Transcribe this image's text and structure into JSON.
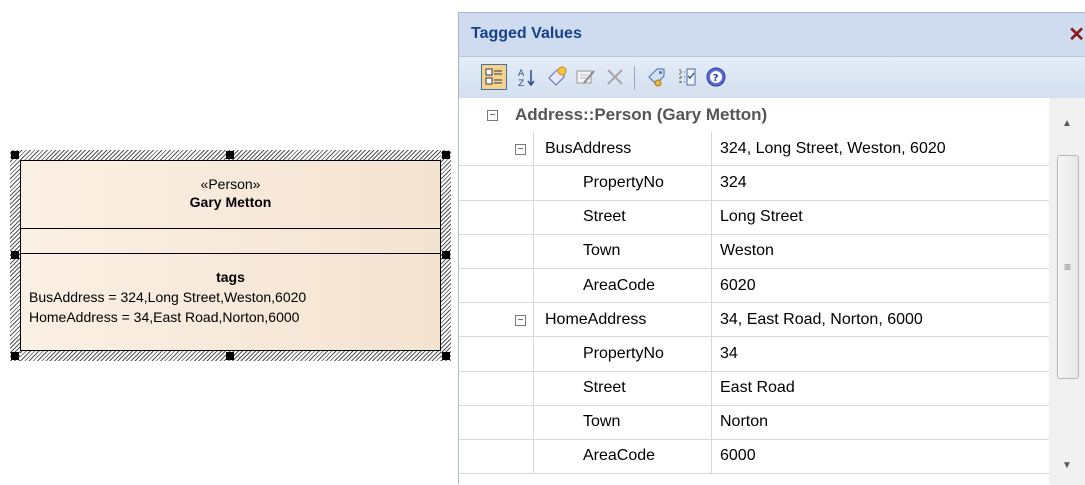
{
  "uml_element": {
    "stereotype": "«Person»",
    "name": "Gary Metton",
    "tags_title": "tags",
    "tag_lines": [
      "BusAddress = 324,Long Street,Weston,6020",
      "HomeAddress = 34,East Road,Norton,6000"
    ]
  },
  "window": {
    "title": "Tagged Values",
    "close": "✕",
    "toolbar_icons": [
      "categorized-view-icon",
      "sort-alphabetical-icon",
      "new-tag-icon",
      "edit-tag-icon",
      "delete-tag-icon",
      "tag-settings-icon",
      "show-inherited-icon",
      "help-icon"
    ]
  },
  "grid": {
    "group": "Address::Person (Gary Metton)",
    "rows": [
      {
        "name": "BusAddress",
        "value": "324, Long Street, Weston, 6020",
        "level": 1,
        "expandable": true
      },
      {
        "name": "PropertyNo",
        "value": "324",
        "level": 2,
        "expandable": false
      },
      {
        "name": "Street",
        "value": "Long Street",
        "level": 2,
        "expandable": false
      },
      {
        "name": "Town",
        "value": "Weston",
        "level": 2,
        "expandable": false
      },
      {
        "name": "AreaCode",
        "value": "6020",
        "level": 2,
        "expandable": false
      },
      {
        "name": "HomeAddress",
        "value": "34, East Road, Norton, 6000",
        "level": 1,
        "expandable": true
      },
      {
        "name": "PropertyNo",
        "value": "34",
        "level": 2,
        "expandable": false
      },
      {
        "name": "Street",
        "value": "East Road",
        "level": 2,
        "expandable": false
      },
      {
        "name": "Town",
        "value": "Norton",
        "level": 2,
        "expandable": false
      },
      {
        "name": "AreaCode",
        "value": "6000",
        "level": 2,
        "expandable": false
      }
    ]
  },
  "colors": {
    "title_text": "#15428b",
    "element_fill": "#f4e3d1"
  }
}
